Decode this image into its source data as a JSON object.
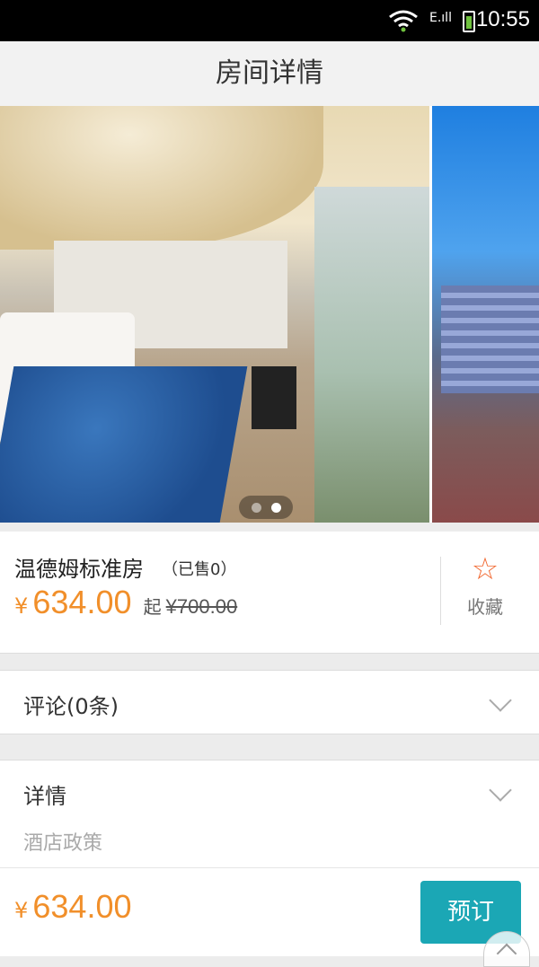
{
  "status_bar": {
    "time": "10:55",
    "signal": "E.ıll"
  },
  "header": {
    "title": "房间详情"
  },
  "room": {
    "name": "温德姆标准房",
    "sold": "（已售0）",
    "currency": "¥",
    "price": "634.00",
    "qi": "起",
    "original_price": "¥700.00",
    "favorite_label": "收藏"
  },
  "reviews": {
    "label": "评论(0条)"
  },
  "details": {
    "label": "详情",
    "sub": "酒店政策"
  },
  "footer": {
    "currency": "¥",
    "price": "634.00",
    "book_label": "预订"
  },
  "colors": {
    "accent_orange": "#f18f2a",
    "book_button": "#1ba7b5",
    "star": "#f16a33"
  },
  "icons": [
    "wifi-icon",
    "signal-icon",
    "battery-icon",
    "star-icon",
    "chevron-down-icon",
    "chevron-up-icon"
  ]
}
